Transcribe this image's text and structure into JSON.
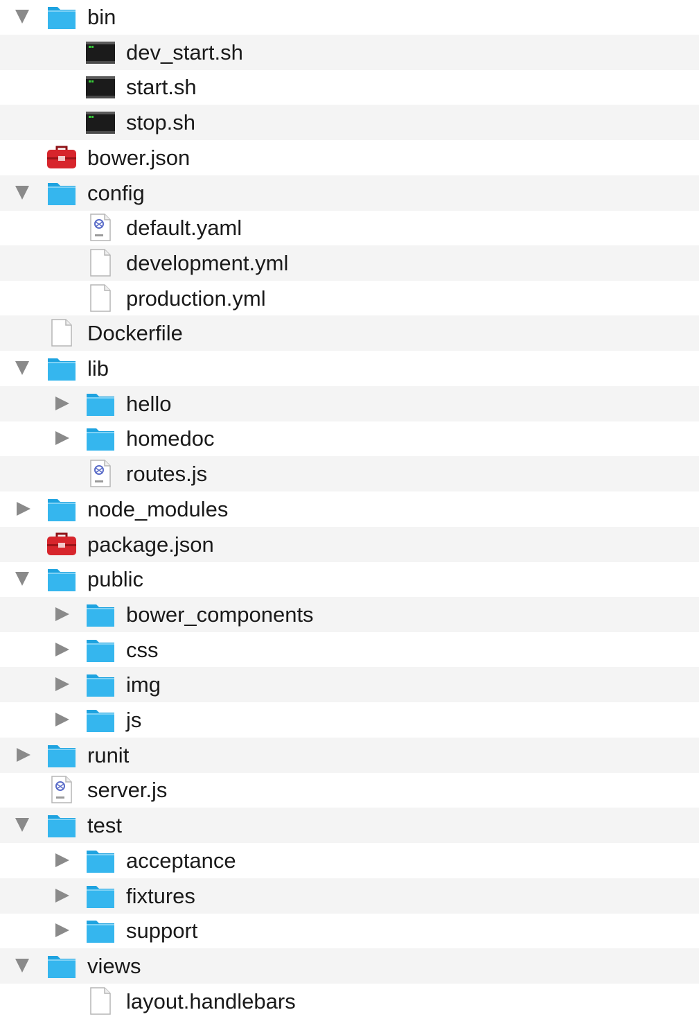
{
  "colors": {
    "folder": "#35b6ee",
    "folder_tab": "#1ea3e0",
    "terminal": "#1b1b1b",
    "npm_red": "#d7252c",
    "row_alt": "#f4f4f4",
    "disclosure": "#8a8a8a"
  },
  "tree": [
    {
      "label": "bin",
      "depth": 0,
      "type": "folder",
      "state": "expanded"
    },
    {
      "label": "dev_start.sh",
      "depth": 1,
      "type": "terminal"
    },
    {
      "label": "start.sh",
      "depth": 1,
      "type": "terminal"
    },
    {
      "label": "stop.sh",
      "depth": 1,
      "type": "terminal"
    },
    {
      "label": "bower.json",
      "depth": 0,
      "type": "toolbox"
    },
    {
      "label": "config",
      "depth": 0,
      "type": "folder",
      "state": "expanded"
    },
    {
      "label": "default.yaml",
      "depth": 1,
      "type": "script"
    },
    {
      "label": "development.yml",
      "depth": 1,
      "type": "document"
    },
    {
      "label": "production.yml",
      "depth": 1,
      "type": "document"
    },
    {
      "label": "Dockerfile",
      "depth": 0,
      "type": "document"
    },
    {
      "label": "lib",
      "depth": 0,
      "type": "folder",
      "state": "expanded"
    },
    {
      "label": "hello",
      "depth": 1,
      "type": "folder",
      "state": "collapsed"
    },
    {
      "label": "homedoc",
      "depth": 1,
      "type": "folder",
      "state": "collapsed"
    },
    {
      "label": "routes.js",
      "depth": 1,
      "type": "script"
    },
    {
      "label": "node_modules",
      "depth": 0,
      "type": "folder",
      "state": "collapsed"
    },
    {
      "label": "package.json",
      "depth": 0,
      "type": "toolbox"
    },
    {
      "label": "public",
      "depth": 0,
      "type": "folder",
      "state": "expanded"
    },
    {
      "label": "bower_components",
      "depth": 1,
      "type": "folder",
      "state": "collapsed"
    },
    {
      "label": "css",
      "depth": 1,
      "type": "folder",
      "state": "collapsed"
    },
    {
      "label": "img",
      "depth": 1,
      "type": "folder",
      "state": "collapsed"
    },
    {
      "label": "js",
      "depth": 1,
      "type": "folder",
      "state": "collapsed"
    },
    {
      "label": "runit",
      "depth": 0,
      "type": "folder",
      "state": "collapsed"
    },
    {
      "label": "server.js",
      "depth": 0,
      "type": "script"
    },
    {
      "label": "test",
      "depth": 0,
      "type": "folder",
      "state": "expanded"
    },
    {
      "label": "acceptance",
      "depth": 1,
      "type": "folder",
      "state": "collapsed"
    },
    {
      "label": "fixtures",
      "depth": 1,
      "type": "folder",
      "state": "collapsed"
    },
    {
      "label": "support",
      "depth": 1,
      "type": "folder",
      "state": "collapsed"
    },
    {
      "label": "views",
      "depth": 0,
      "type": "folder",
      "state": "expanded"
    },
    {
      "label": "layout.handlebars",
      "depth": 1,
      "type": "document"
    }
  ]
}
